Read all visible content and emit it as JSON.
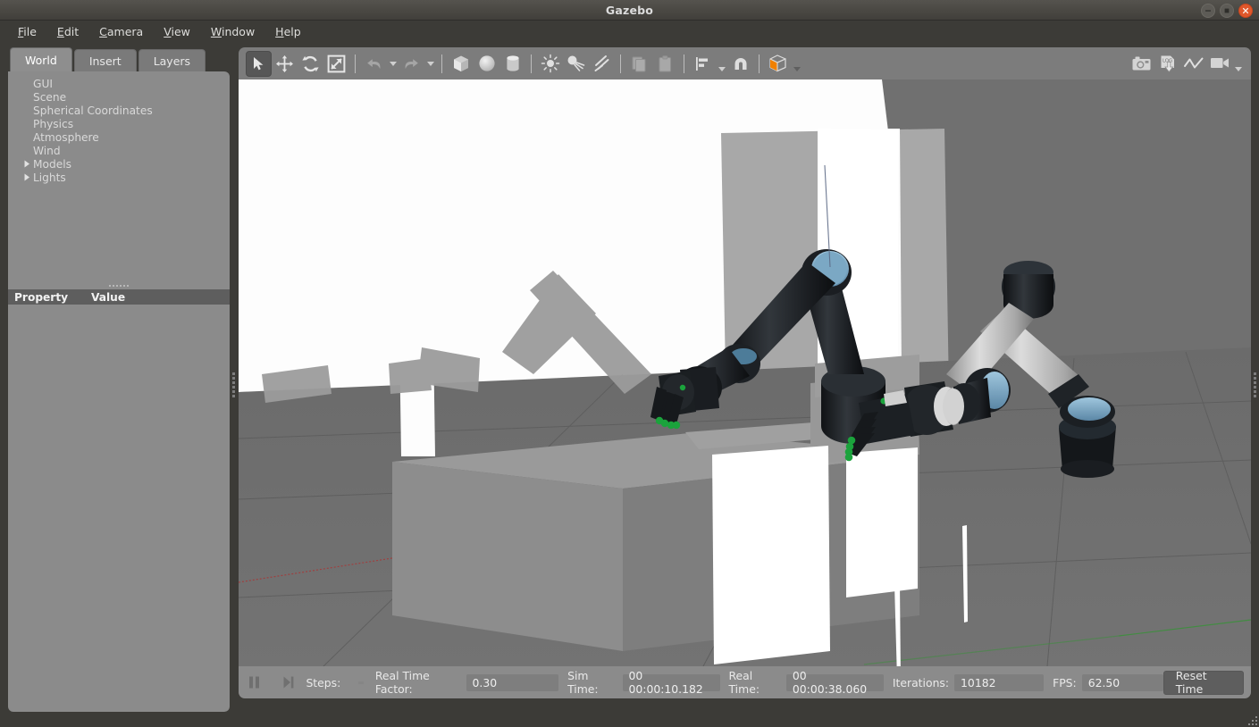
{
  "window": {
    "title": "Gazebo",
    "controls": [
      {
        "name": "minimize-button",
        "glyph": "minus"
      },
      {
        "name": "maximize-button",
        "glyph": "square"
      },
      {
        "name": "close-button",
        "glyph": "x",
        "color": "#e0572b"
      }
    ]
  },
  "menubar": {
    "items": [
      "File",
      "Edit",
      "Camera",
      "View",
      "Window",
      "Help"
    ]
  },
  "left_panel": {
    "tabs": [
      {
        "label": "World",
        "active": true
      },
      {
        "label": "Insert",
        "active": false
      },
      {
        "label": "Layers",
        "active": false
      }
    ],
    "tree": [
      {
        "label": "GUI",
        "expandable": false
      },
      {
        "label": "Scene",
        "expandable": false
      },
      {
        "label": "Spherical Coordinates",
        "expandable": false
      },
      {
        "label": "Physics",
        "expandable": false
      },
      {
        "label": "Atmosphere",
        "expandable": false
      },
      {
        "label": "Wind",
        "expandable": false
      },
      {
        "label": "Models",
        "expandable": true
      },
      {
        "label": "Lights",
        "expandable": true
      }
    ],
    "property_table": {
      "columns": [
        "Property",
        "Value"
      ],
      "rows": []
    }
  },
  "toolbar": {
    "left_group": [
      {
        "name": "select-mode-button",
        "icon": "cursor-arrow-icon",
        "active": true,
        "enabled": true
      },
      {
        "name": "translate-mode-button",
        "icon": "move-arrows-icon",
        "active": false,
        "enabled": true
      },
      {
        "name": "rotate-mode-button",
        "icon": "rotate-arrows-icon",
        "active": false,
        "enabled": true
      },
      {
        "name": "scale-mode-button",
        "icon": "scale-arrows-icon",
        "active": false,
        "enabled": true
      },
      {
        "name": "undo-button",
        "icon": "undo-arrow-icon",
        "active": false,
        "enabled": false
      },
      {
        "name": "undo-history-dropdown",
        "icon": "chevron-down-icon",
        "active": false,
        "enabled": false
      },
      {
        "name": "redo-button",
        "icon": "redo-arrow-icon",
        "active": false,
        "enabled": false
      },
      {
        "name": "redo-history-dropdown",
        "icon": "chevron-down-icon",
        "active": false,
        "enabled": false
      },
      {
        "name": "insert-box-button",
        "icon": "box-icon",
        "active": false,
        "enabled": true
      },
      {
        "name": "insert-sphere-button",
        "icon": "sphere-icon",
        "active": false,
        "enabled": true
      },
      {
        "name": "insert-cylinder-button",
        "icon": "cylinder-icon",
        "active": false,
        "enabled": true
      },
      {
        "name": "insert-point-light-button",
        "icon": "point-light-icon",
        "active": false,
        "enabled": true
      },
      {
        "name": "insert-spot-light-button",
        "icon": "spot-light-icon",
        "active": false,
        "enabled": true
      },
      {
        "name": "insert-directional-light-button",
        "icon": "directional-light-icon",
        "active": false,
        "enabled": true
      },
      {
        "name": "copy-button",
        "icon": "copy-icon",
        "active": false,
        "enabled": false
      },
      {
        "name": "paste-button",
        "icon": "paste-icon",
        "active": false,
        "enabled": false
      },
      {
        "name": "align-button",
        "icon": "align-icon",
        "active": false,
        "enabled": true
      },
      {
        "name": "snap-button",
        "icon": "magnet-snap-icon",
        "active": false,
        "enabled": true
      },
      {
        "name": "view-angle-button",
        "icon": "view-cube-icon",
        "active": false,
        "enabled": true
      }
    ],
    "right_group": [
      {
        "name": "screenshot-button",
        "icon": "camera-icon"
      },
      {
        "name": "log-data-button",
        "icon": "log-download-icon",
        "label": "LOG"
      },
      {
        "name": "plot-button",
        "icon": "plot-line-icon"
      },
      {
        "name": "record-video-button",
        "icon": "video-camera-icon"
      }
    ],
    "accent_color": "#f08000"
  },
  "statusbar": {
    "pause_button": "pause-icon",
    "step_button": "step-forward-icon",
    "steps_label": "Steps:",
    "steps_value": "",
    "real_time_factor_label": "Real Time Factor:",
    "real_time_factor_value": "0.30",
    "sim_time_label": "Sim Time:",
    "sim_time_value": "00 00:00:10.182",
    "real_time_label": "Real Time:",
    "real_time_value": "00 00:00:38.060",
    "iterations_label": "Iterations:",
    "iterations_value": "10182",
    "fps_label": "FPS:",
    "fps_value": "62.50",
    "reset_time_label": "Reset Time"
  },
  "scene": {
    "description": "Gazebo 3D viewport: two dark UR-style robotic arms with five-finger hands on a grey table, white backdrop panels, grey ground plane with grid",
    "background_color": "#707070",
    "ground_color": "#6e6e6e",
    "table_color": "#8a8a8a",
    "panel_color": "#fcfcfc",
    "robot_dark_color": "#1e2124",
    "robot_joint_color": "#6f9fc0",
    "robot_light_link_color": "#c9c9c9",
    "fingertip_color": "#19a03a",
    "x_axis_color": "#aa3333",
    "y_axis_color": "#339933",
    "grid_color": "#5f5f5f"
  }
}
